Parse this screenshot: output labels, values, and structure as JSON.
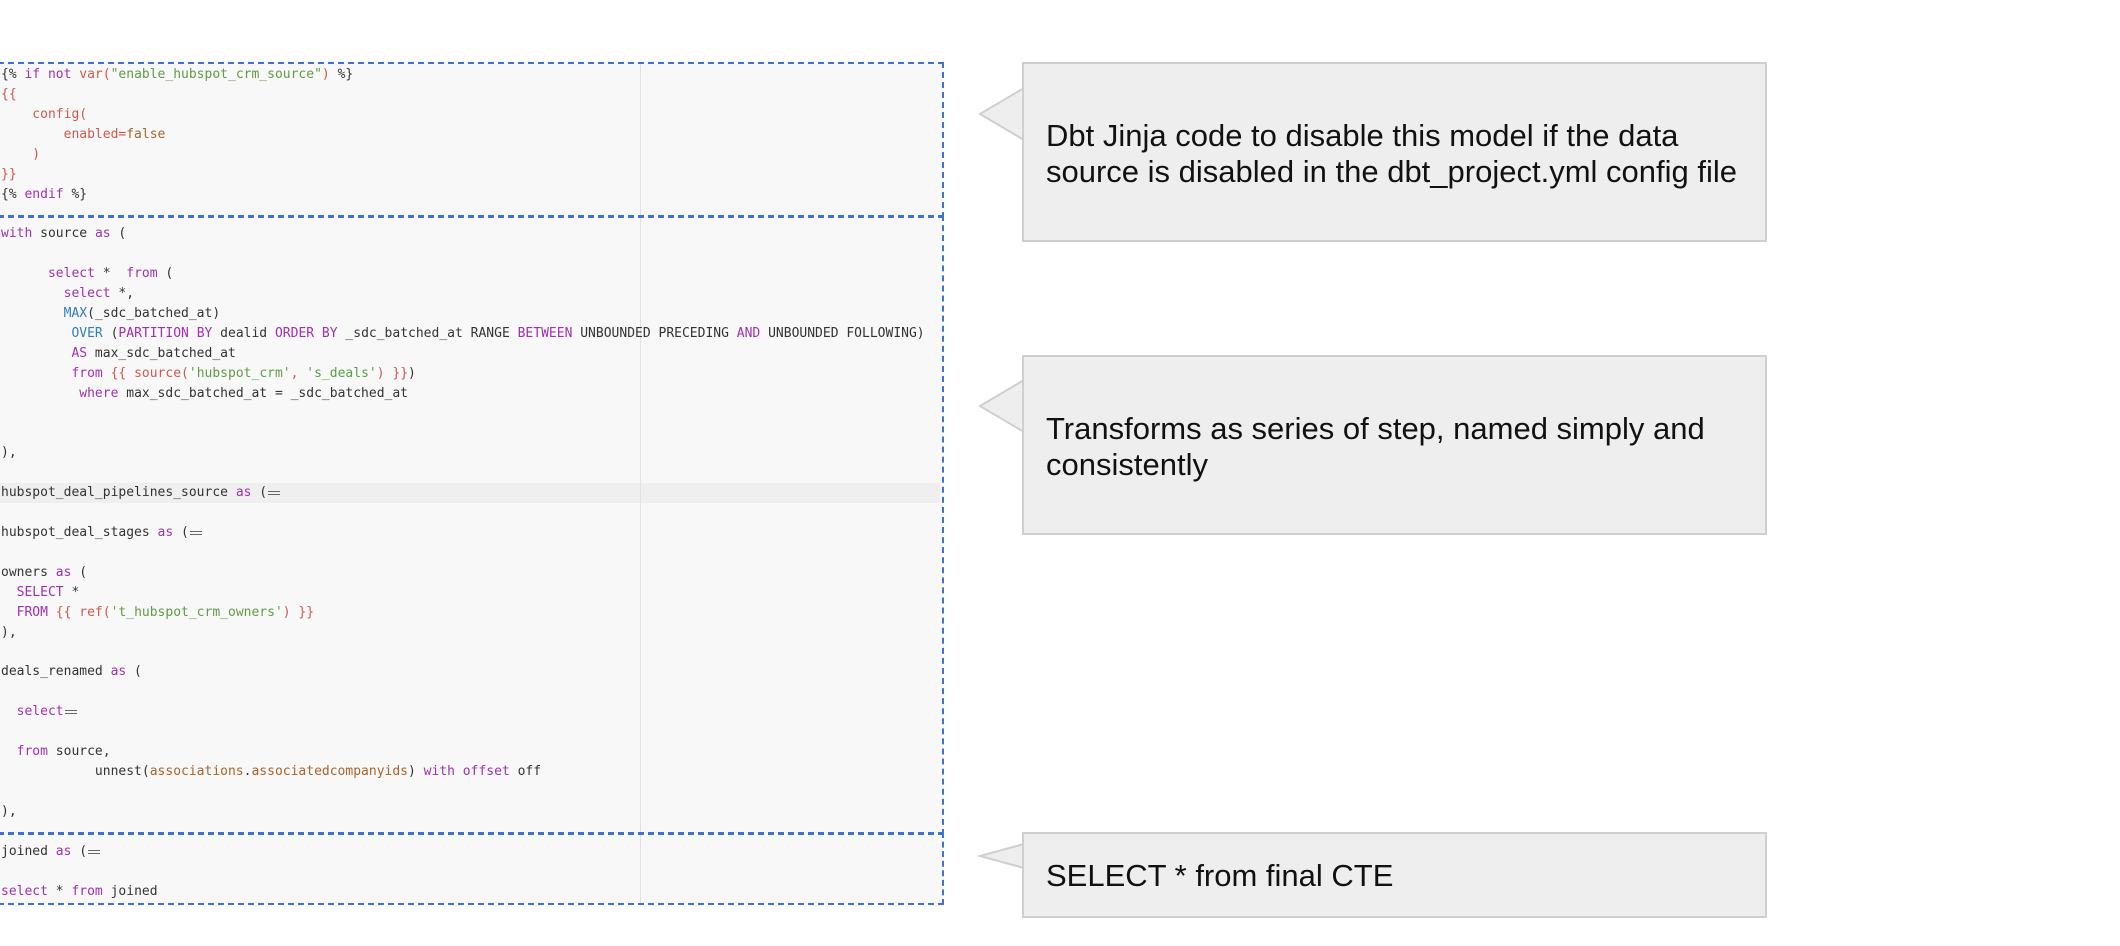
{
  "code_lines": [
    "{% if not var(\"enable_hubspot_crm_source\") %}",
    "{{",
    "    config(",
    "        enabled=false",
    "    )",
    "}}",
    "{% endif %}",
    "with source as (",
    "",
    "      select *  from (",
    "        select *,",
    "        MAX(_sdc_batched_at)",
    "         OVER (PARTITION BY dealid ORDER BY _sdc_batched_at RANGE BETWEEN UNBOUNDED PRECEDING AND UNBOUNDED FOLLOWING)",
    "         AS max_sdc_batched_at",
    "         from {{ source('hubspot_crm', 's_deals') }})",
    "          where max_sdc_batched_at = _sdc_batched_at",
    "",
    "",
    "),",
    "",
    "hubspot_deal_pipelines_source as (",
    "",
    "hubspot_deal_stages as (",
    "",
    "owners as (",
    "  SELECT *",
    "  FROM {{ ref('t_hubspot_crm_owners') }}",
    "),",
    "",
    "deals_renamed as (",
    "",
    "  select",
    "",
    "  from source,",
    "            unnest(associations.associatedcompanyids) with offset off",
    "",
    "),",
    "joined as (",
    "",
    "select * from joined"
  ],
  "annotations": {
    "jinja": "Dbt Jinja code to disable this model if the data source is disabled in the dbt_project.yml config file",
    "ctes": "Transforms as series of step, named simply and consistently",
    "final": "SELECT * from final CTE"
  }
}
